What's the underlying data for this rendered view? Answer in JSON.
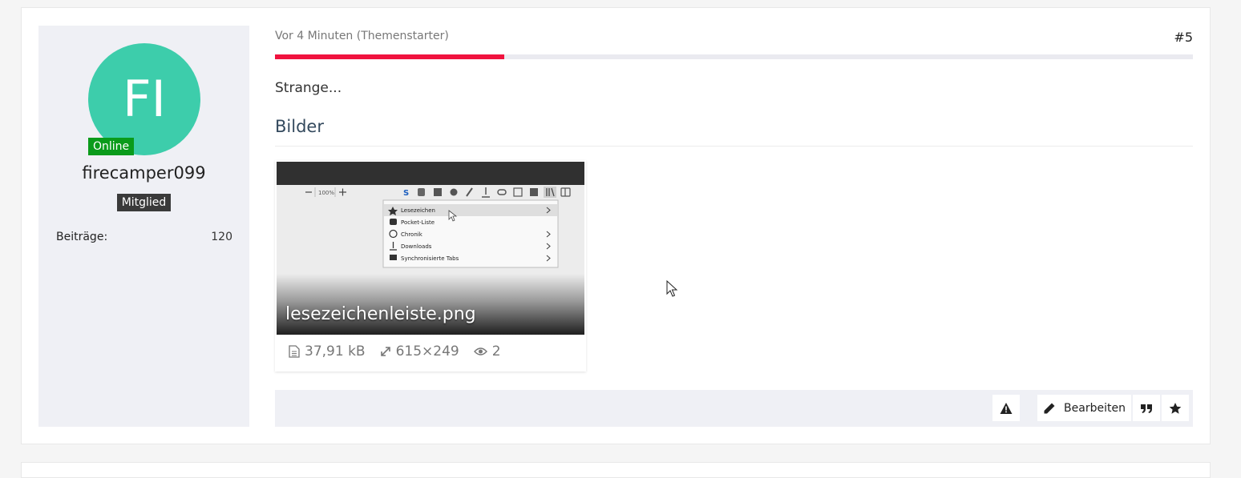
{
  "user": {
    "avatar_initials": "FI",
    "avatar_color": "#3dcdab",
    "online_label": "Online",
    "online_color": "#0a9b1b",
    "username": "firecamper099",
    "rank": "Mitglied",
    "stats": [
      {
        "label": "Beiträge",
        "value": "120"
      }
    ]
  },
  "post": {
    "time": "Vor 4 Minuten (Themenstarter)",
    "number": "#5",
    "read_progress": 0.25,
    "accent_color": "#f0123e",
    "text": "Strange...",
    "section_title": "Bilder"
  },
  "attachment": {
    "filename": "lesezeichenleiste.png",
    "size": "37,91 kB",
    "dimensions": "615×249",
    "views": "2",
    "thumbnail": {
      "zoom": "100%",
      "menu_items": [
        "Lesezeichen",
        "Pocket-Liste",
        "Chronik",
        "Downloads",
        "Synchronisierte Tabs"
      ]
    }
  },
  "actions": {
    "report_icon": "warning-icon",
    "edit_label": "Bearbeiten",
    "edit_icon": "pencil-icon",
    "quote_icon": "quote-icon",
    "bookmark_icon": "star-icon"
  }
}
